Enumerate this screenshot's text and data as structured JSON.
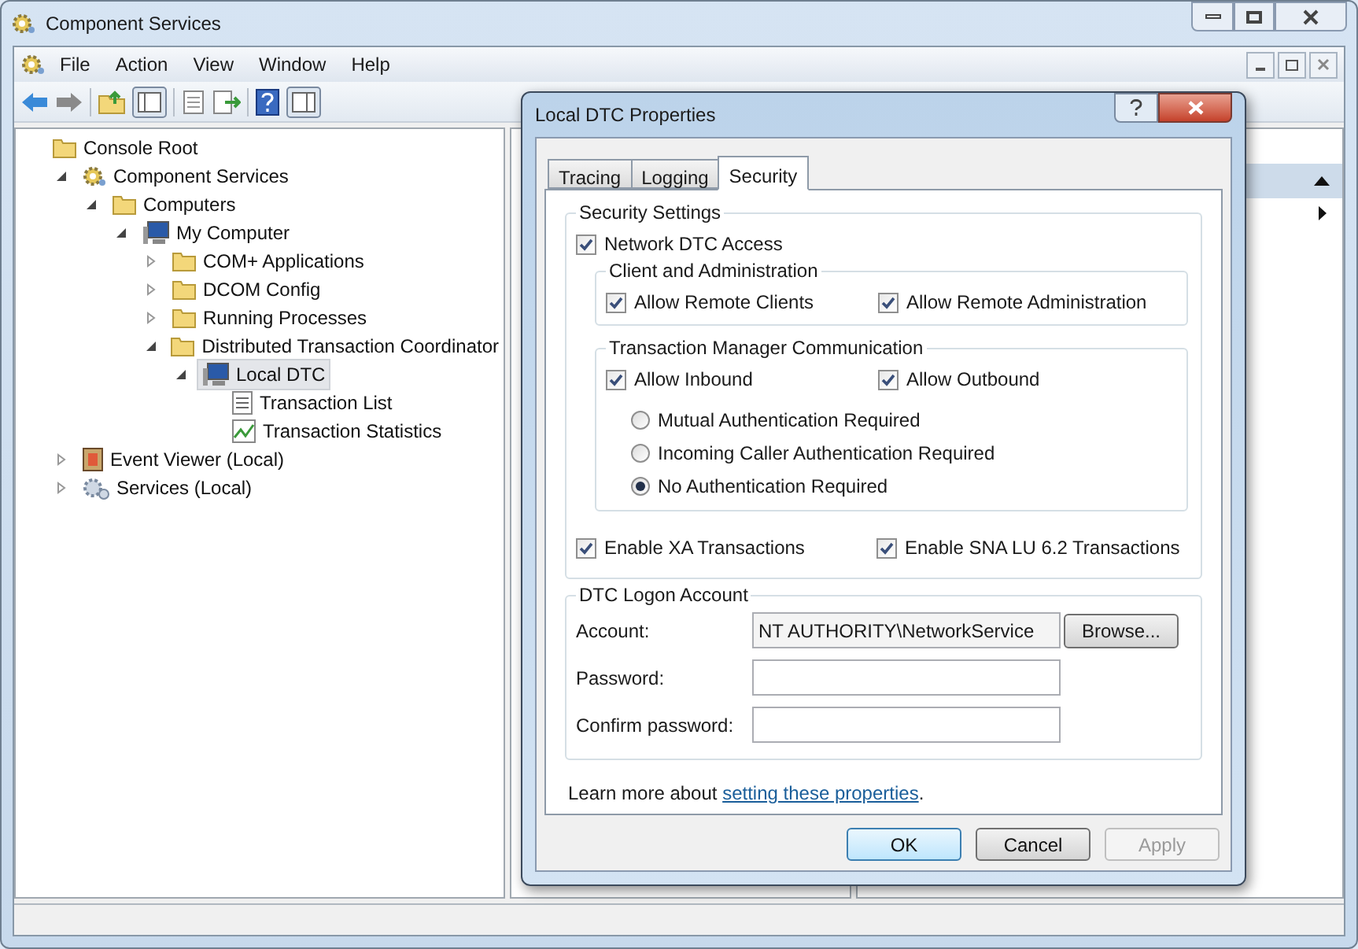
{
  "window": {
    "title": "Component Services"
  },
  "menu": [
    "File",
    "Action",
    "View",
    "Window",
    "Help"
  ],
  "tree": [
    {
      "label": "Console Root",
      "kind": "folder",
      "selected": false,
      "children": [
        {
          "label": "Component Services",
          "kind": "gear",
          "expanded": true,
          "selected": false,
          "children": [
            {
              "label": "Computers",
              "kind": "folder",
              "expanded": true,
              "selected": false,
              "children": [
                {
                  "label": "My Computer",
                  "kind": "computer",
                  "expanded": true,
                  "selected": false,
                  "children": [
                    {
                      "label": "COM+ Applications",
                      "kind": "folder",
                      "expanded": false,
                      "selected": false
                    },
                    {
                      "label": "DCOM Config",
                      "kind": "folder",
                      "expanded": false,
                      "selected": false
                    },
                    {
                      "label": "Running Processes",
                      "kind": "folder",
                      "expanded": false,
                      "selected": false
                    },
                    {
                      "label": "Distributed Transaction Coordinator",
                      "kind": "folder",
                      "expanded": true,
                      "selected": false,
                      "children": [
                        {
                          "label": "Local DTC",
                          "kind": "computer",
                          "expanded": true,
                          "selected": true,
                          "children": [
                            {
                              "label": "Transaction List",
                              "kind": "list",
                              "selected": false
                            },
                            {
                              "label": "Transaction Statistics",
                              "kind": "chart",
                              "selected": false
                            }
                          ]
                        }
                      ]
                    }
                  ]
                }
              ]
            }
          ]
        },
        {
          "label": "Event Viewer (Local)",
          "kind": "log",
          "expanded": false,
          "selected": false
        },
        {
          "label": "Services (Local)",
          "kind": "services",
          "expanded": false,
          "selected": false
        }
      ]
    }
  ],
  "dialog": {
    "title": "Local DTC Properties",
    "tabs": [
      {
        "label": "Tracing",
        "selected": false
      },
      {
        "label": "Logging",
        "selected": false
      },
      {
        "label": "Security",
        "selected": true
      }
    ],
    "security_settings": {
      "title": "Security Settings",
      "network_access": {
        "label": "Network DTC Access",
        "checked": true
      },
      "client_admin": {
        "title": "Client and Administration",
        "options": [
          {
            "label": "Allow Remote Clients",
            "checked": true
          },
          {
            "label": "Allow Remote Administration",
            "checked": true
          }
        ]
      },
      "tm_communication": {
        "title": "Transaction Manager Communication",
        "options": [
          {
            "label": "Allow Inbound",
            "checked": true
          },
          {
            "label": "Allow Outbound",
            "checked": true
          }
        ],
        "auth": [
          {
            "label": "Mutual Authentication Required",
            "selected": false
          },
          {
            "label": "Incoming Caller Authentication Required",
            "selected": false
          },
          {
            "label": "No Authentication Required",
            "selected": true
          }
        ]
      },
      "transactions": [
        {
          "label": "Enable XA Transactions",
          "checked": true
        },
        {
          "label": "Enable SNA LU 6.2 Transactions",
          "checked": true
        }
      ]
    },
    "logon": {
      "title": "DTC Logon Account",
      "fields": [
        {
          "label": "Account:",
          "value": "NT AUTHORITY\\NetworkService"
        },
        {
          "label": "Password:"
        },
        {
          "label": "Confirm password:"
        }
      ],
      "browse": "Browse..."
    },
    "learn_more": {
      "text": "Learn more about",
      "link": "setting these properties",
      "after": "."
    },
    "buttons": [
      {
        "label": "OK",
        "disabled": false,
        "default": true
      },
      {
        "label": "Cancel",
        "disabled": false,
        "default": false
      },
      {
        "label": "Apply",
        "disabled": true,
        "default": false
      }
    ]
  }
}
